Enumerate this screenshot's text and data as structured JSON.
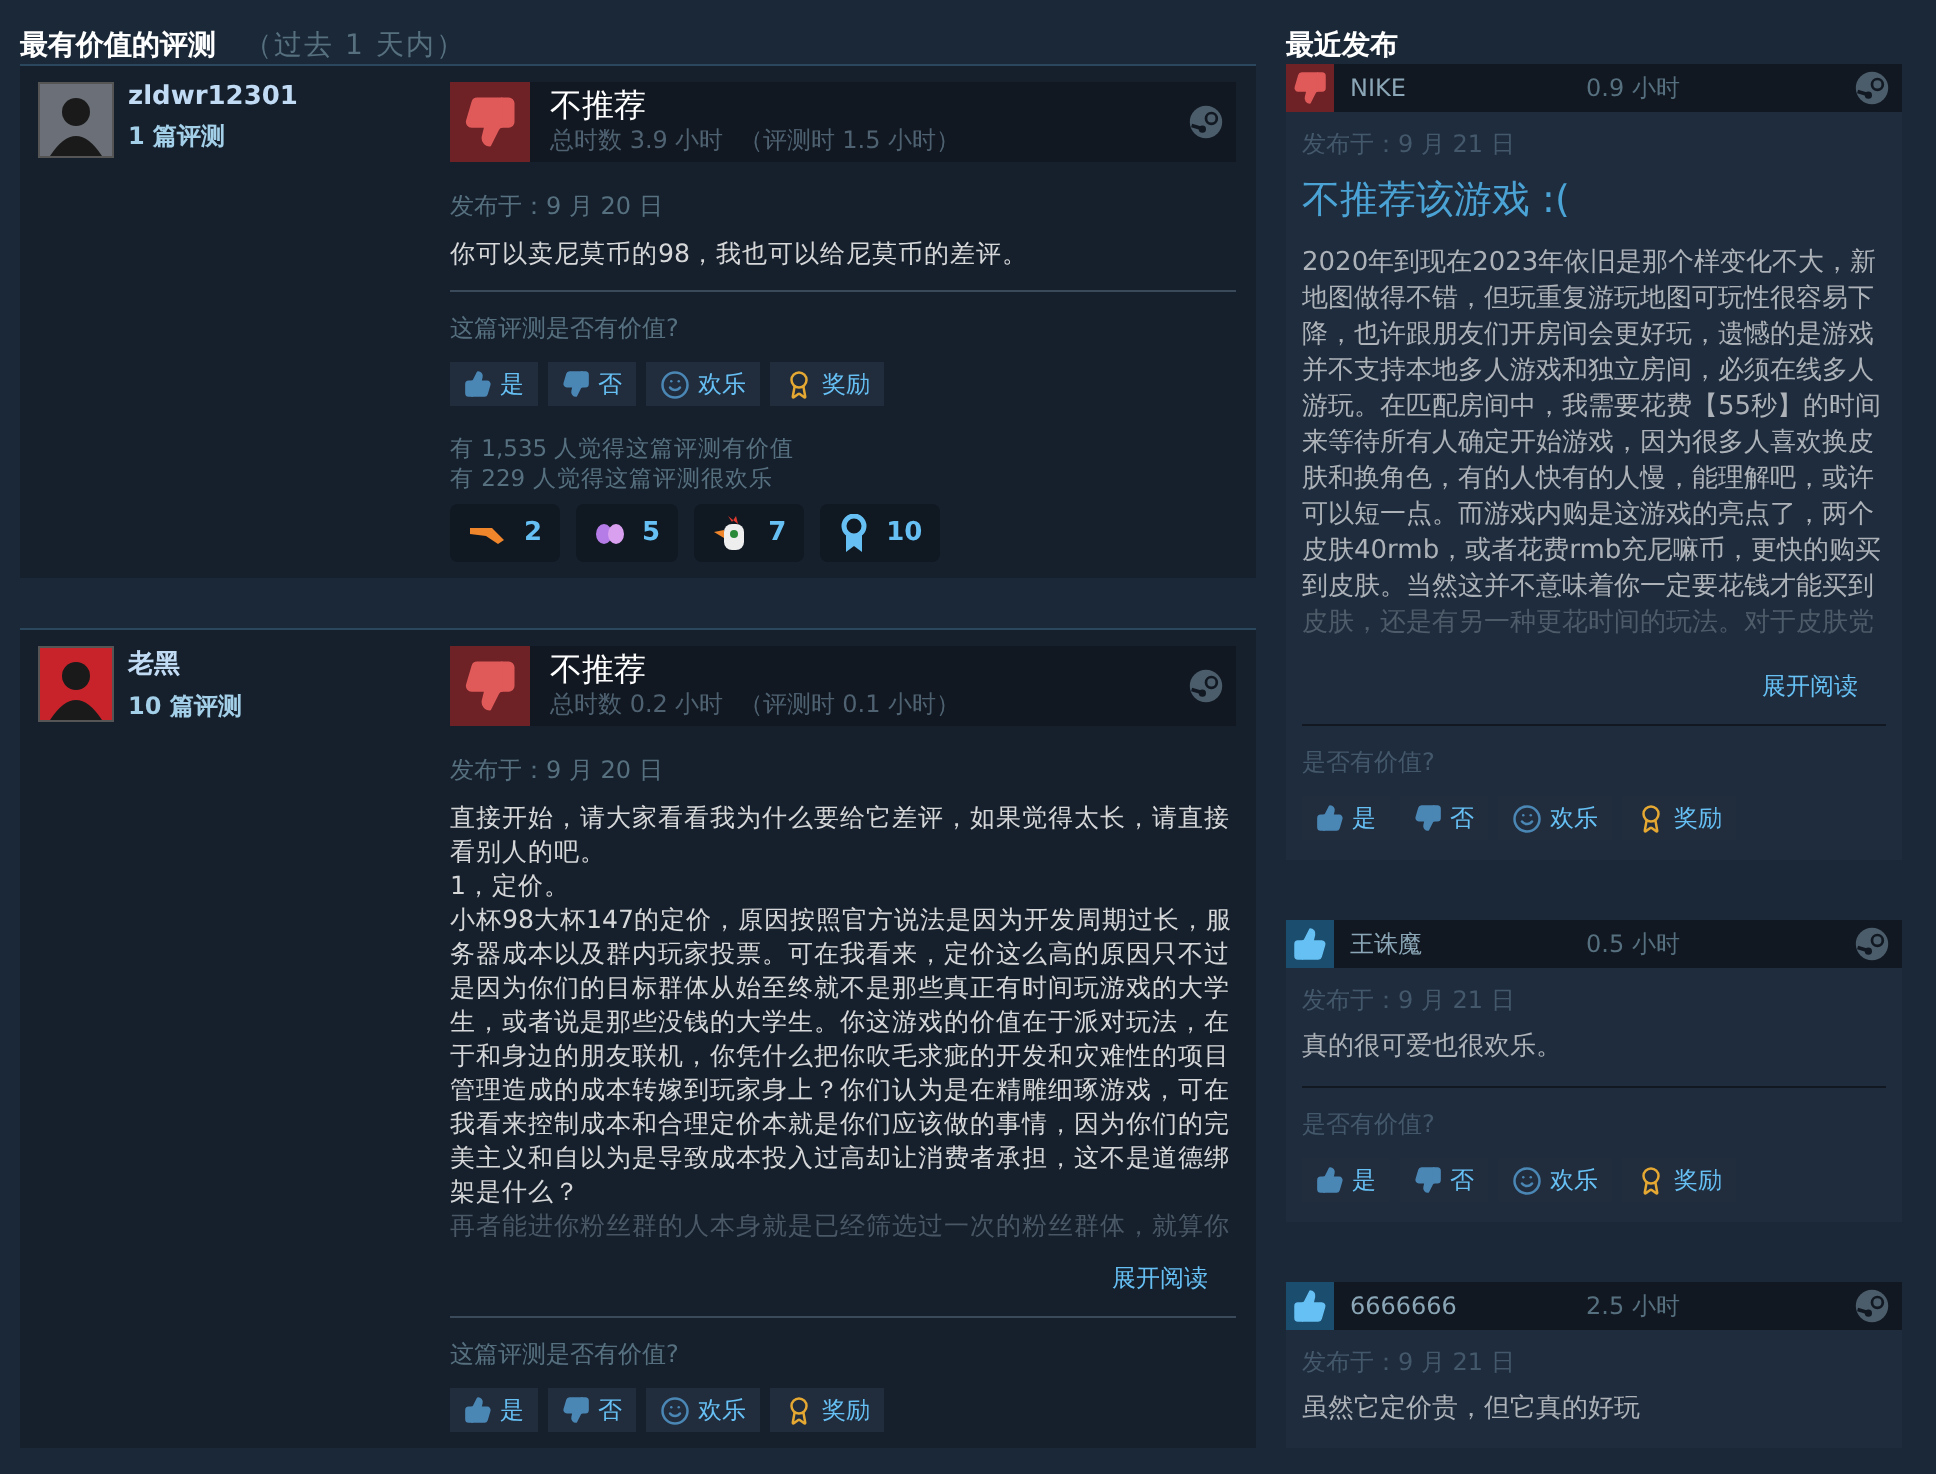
{
  "most_helpful": {
    "title": "最有价值的评测",
    "subtitle": "（过去 1 天内）",
    "reviews": [
      {
        "author": "zldwr12301",
        "review_count": "1 篇评测",
        "avatar": {
          "color": "#6b7078"
        },
        "recommended": false,
        "verdict": "不推荐",
        "hours": "总时数 3.9 小时",
        "hours_at_review": "（评测时 1.5 小时）",
        "posted": "发布于：9 月 20 日",
        "paragraphs": [
          "你可以卖尼莫币的98，我也可以给尼莫币的差评。"
        ],
        "helpful_prompt": "这篇评测是否有价值?",
        "buttons": [
          {
            "kind": "yes",
            "label": "是"
          },
          {
            "kind": "no",
            "label": "否"
          },
          {
            "kind": "funny",
            "label": "欢乐"
          },
          {
            "kind": "award",
            "label": "奖励"
          }
        ],
        "stats": [
          "有 1,535 人觉得这篇评测有价值",
          "有 229 人觉得这篇评测很欢乐"
        ],
        "awards": [
          {
            "kind": "hand",
            "count": "2"
          },
          {
            "kind": "wings",
            "count": "5"
          },
          {
            "kind": "rooster",
            "count": "7"
          },
          {
            "kind": "medal",
            "count": "10"
          }
        ]
      },
      {
        "author": "老黑",
        "review_count": "10 篇评测",
        "avatar": {
          "color": "#c8232b"
        },
        "recommended": false,
        "verdict": "不推荐",
        "hours": "总时数 0.2 小时",
        "hours_at_review": "（评测时 0.1 小时）",
        "posted": "发布于：9 月 20 日",
        "paragraphs": [
          "直接开始，请大家看看我为什么要给它差评，如果觉得太长，请直接看别人的吧。",
          "1，定价。",
          "小杯98大杯147的定价，原因按照官方说法是因为开发周期过长，服务器成本以及群内玩家投票。可在我看来，定价这么高的原因只不过是因为你们的目标群体从始至终就不是那些真正有时间玩游戏的大学生，或者说是那些没钱的大学生。你这游戏的价值在于派对玩法，在于和身边的朋友联机，你凭什么把你吹毛求疵的开发和灾难性的项目管理造成的成本转嫁到玩家身上？你们认为是在精雕细琢游戏，可在我看来控制成本和合理定价本就是你们应该做的事情，因为你们的完美主义和自以为是导致成本投入过高却让消费者承担，这不是道德绑架是什么？"
        ],
        "faded_text": "再者能进你粉丝群的人本身就是已经筛选过一次的粉丝群体，就算你",
        "read_more": "展开阅读",
        "helpful_prompt": "这篇评测是否有价值?",
        "buttons": [
          {
            "kind": "yes",
            "label": "是"
          },
          {
            "kind": "no",
            "label": "否"
          },
          {
            "kind": "funny",
            "label": "欢乐"
          },
          {
            "kind": "award",
            "label": "奖励"
          }
        ]
      }
    ]
  },
  "recent": {
    "title": "最近发布",
    "reviews": [
      {
        "author": "NIKE",
        "recommended": false,
        "hours": "0.9 小时",
        "posted": "发布于：9 月 21 日",
        "headline": "不推荐该游戏 :(",
        "text": "2020年到现在2023年依旧是那个样变化不大，新地图做得不错，但玩重复游玩地图可玩性很容易下降，也许跟朋友们开房间会更好玩，遗憾的是游戏并不支持本地多人游戏和独立房间，必须在线多人游玩。在匹配房间中，我需要花费【55秒】的时间来等待所有人确定开始游戏，因为很多人喜欢换皮肤和换角色，有的人快有的人慢，能理解吧，或许可以短一点。而游戏内购是这游戏的亮点了，两个皮肤40rmb，或者花费rmb充尼嘛币，更快的购买到皮肤。当然这并不意味着你一定要花钱才能买到",
        "faded_text": "皮肤，还是有另一种更花时间的玩法。对于皮肤党",
        "read_more": "展开阅读",
        "helpful_prompt": "是否有价值?",
        "buttons": [
          {
            "kind": "yes",
            "label": "是"
          },
          {
            "kind": "no",
            "label": "否"
          },
          {
            "kind": "funny",
            "label": "欢乐"
          },
          {
            "kind": "award",
            "label": "奖励"
          }
        ]
      },
      {
        "author": "王诛魔",
        "recommended": true,
        "hours": "0.5 小时",
        "posted": "发布于：9 月 21 日",
        "text": "真的很可爱也很欢乐。",
        "helpful_prompt": "是否有价值?",
        "buttons": [
          {
            "kind": "yes",
            "label": "是"
          },
          {
            "kind": "no",
            "label": "否"
          },
          {
            "kind": "funny",
            "label": "欢乐"
          },
          {
            "kind": "award",
            "label": "奖励"
          }
        ]
      },
      {
        "author": "6666666",
        "recommended": true,
        "hours": "2.5 小时",
        "posted": "发布于：9 月 21 日",
        "text": "虽然它定价贵，但它真的好玩"
      }
    ]
  }
}
